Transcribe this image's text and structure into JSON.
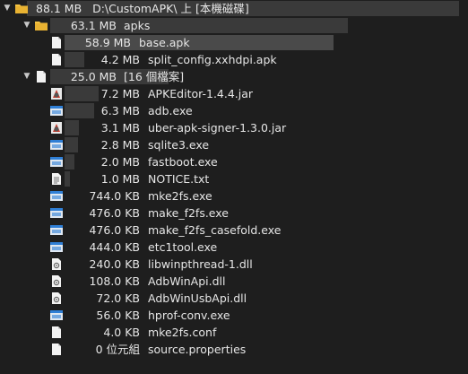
{
  "tree": {
    "root": {
      "size": "88.1 MB",
      "name": "D:\\CustomAPK\\ 上 [本機磁碟]"
    },
    "apks": {
      "size": "63.1 MB",
      "name": "apks"
    },
    "base": {
      "size": "58.9 MB",
      "name": "base.apk"
    },
    "split": {
      "size": "4.2 MB",
      "name": "split_config.xxhdpi.apk"
    },
    "group": {
      "size": "25.0 MB",
      "name": "[16 個檔案]"
    },
    "files": [
      {
        "size": "7.2 MB",
        "name": "APKEditor-1.4.4.jar",
        "icon": "jar-icon"
      },
      {
        "size": "6.3 MB",
        "name": "adb.exe",
        "icon": "exe-icon"
      },
      {
        "size": "3.1 MB",
        "name": "uber-apk-signer-1.3.0.jar",
        "icon": "jar-icon"
      },
      {
        "size": "2.8 MB",
        "name": "sqlite3.exe",
        "icon": "exe-icon"
      },
      {
        "size": "2.0 MB",
        "name": "fastboot.exe",
        "icon": "exe-icon"
      },
      {
        "size": "1.0 MB",
        "name": "NOTICE.txt",
        "icon": "text-file-icon"
      },
      {
        "size": "744.0 KB",
        "name": "mke2fs.exe",
        "icon": "exe-icon"
      },
      {
        "size": "476.0 KB",
        "name": "make_f2fs.exe",
        "icon": "exe-icon"
      },
      {
        "size": "476.0 KB",
        "name": "make_f2fs_casefold.exe",
        "icon": "exe-icon"
      },
      {
        "size": "444.0 KB",
        "name": "etc1tool.exe",
        "icon": "exe-icon"
      },
      {
        "size": "240.0 KB",
        "name": "libwinpthread-1.dll",
        "icon": "dll-icon"
      },
      {
        "size": "108.0 KB",
        "name": "AdbWinApi.dll",
        "icon": "dll-icon"
      },
      {
        "size": "72.0 KB",
        "name": "AdbWinUsbApi.dll",
        "icon": "dll-icon"
      },
      {
        "size": "56.0 KB",
        "name": "hprof-conv.exe",
        "icon": "exe-icon"
      },
      {
        "size": "4.0 KB",
        "name": "mke2fs.conf",
        "icon": "file-icon"
      },
      {
        "size": "0 位元組",
        "name": "source.properties",
        "icon": "file-icon"
      }
    ]
  },
  "colors": {
    "background": "#1e1e1e",
    "bar": "#3a3a3a",
    "folder": "#f5c342",
    "exe_blue": "#2f7fd6"
  }
}
